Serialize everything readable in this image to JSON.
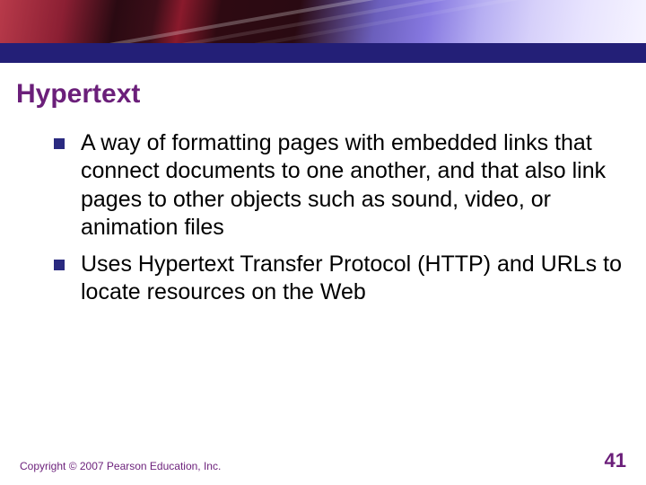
{
  "title": "Hypertext",
  "bullets": [
    "A way of formatting pages with embedded links that connect documents to one another, and that also link pages to other objects such as sound, video, or animation files",
    "Uses Hypertext Transfer Protocol (HTTP) and URLs to locate resources on the Web"
  ],
  "footer": {
    "copyright": "Copyright © 2007 Pearson Education, Inc.",
    "page_number": "41"
  },
  "colors": {
    "accent_purple": "#6b1f7a",
    "bullet_navy": "#2a2a80",
    "stripe_navy": "#231f77"
  }
}
